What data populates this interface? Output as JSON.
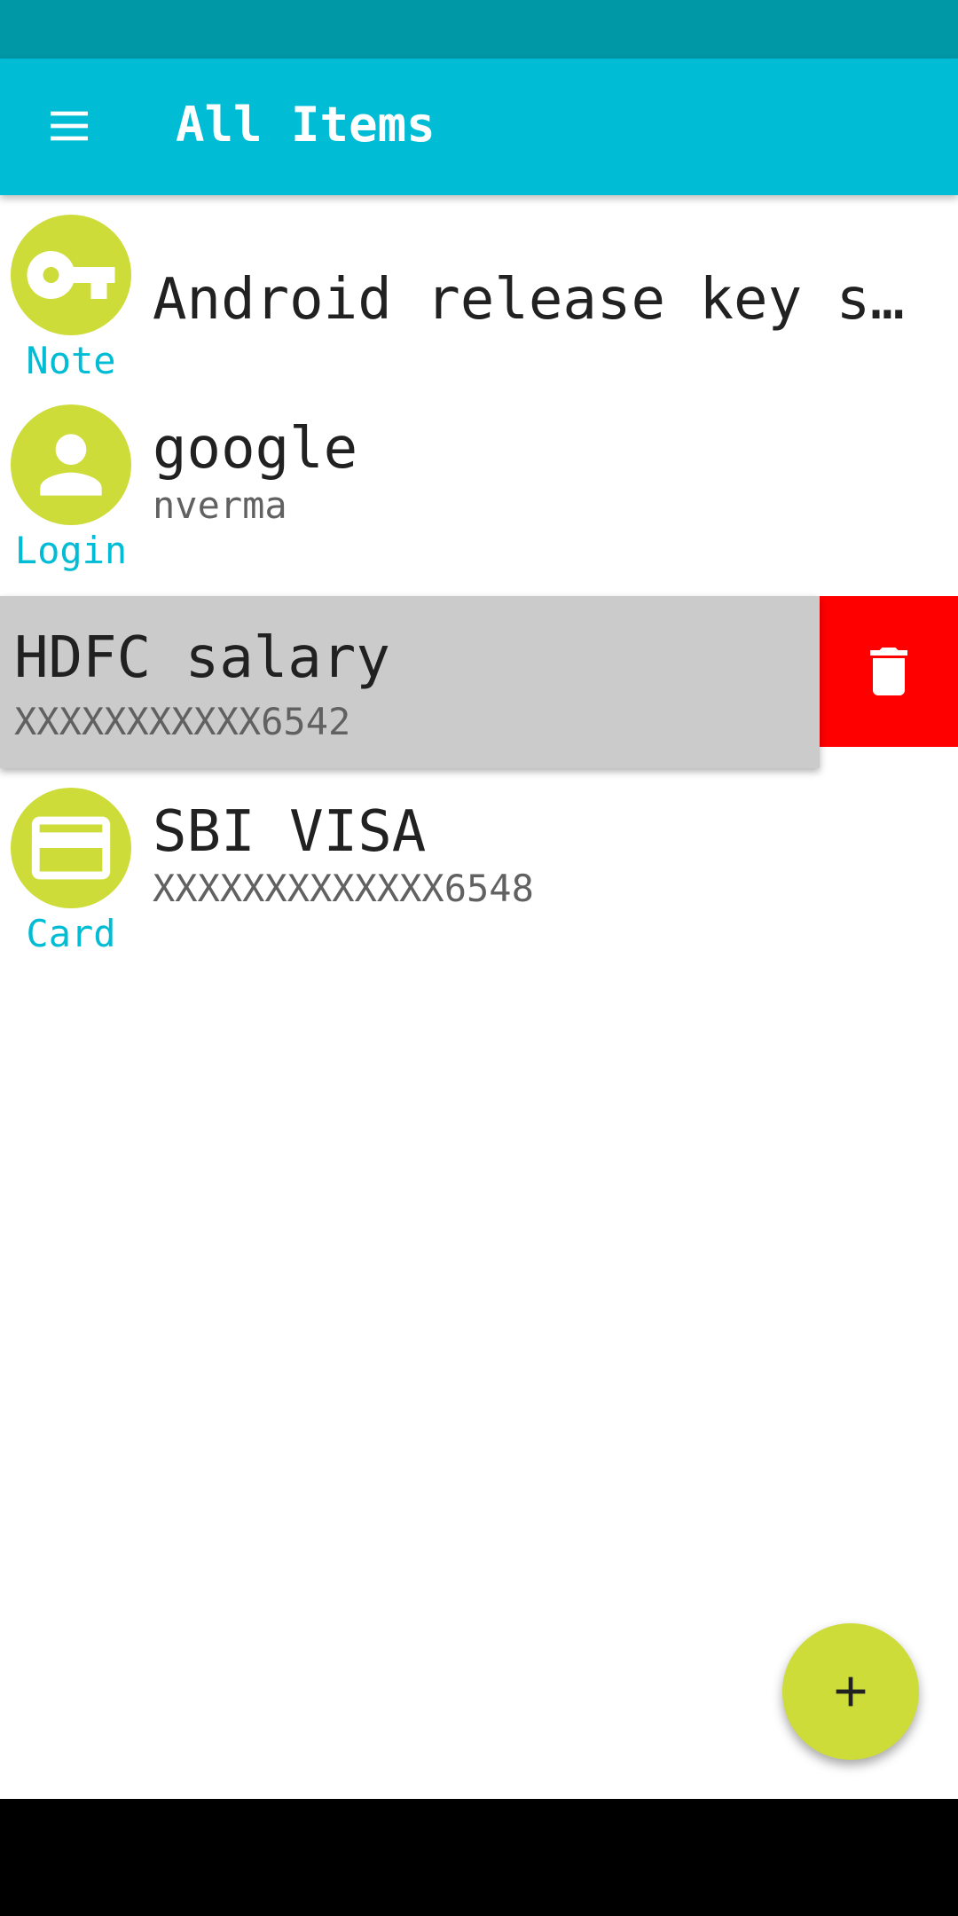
{
  "app_bar": {
    "title": "All Items",
    "menu_icon": "hamburger-menu-icon"
  },
  "items": [
    {
      "type_label": "Note",
      "icon": "key-icon",
      "title": "Android release key s…",
      "subtitle": ""
    },
    {
      "type_label": "Login",
      "icon": "person-icon",
      "title": "google",
      "subtitle": "nverma"
    },
    {
      "type_label": "",
      "icon": "",
      "title": "HDFC salary",
      "subtitle": "XXXXXXXXXXX6542",
      "swiped": true
    },
    {
      "type_label": "Card",
      "icon": "credit-card-icon",
      "title": "SBI VISA",
      "subtitle": "XXXXXXXXXXXXX6548"
    }
  ],
  "swipe_action": {
    "icon": "trash-icon",
    "color": "#ff0000"
  },
  "fab": {
    "icon": "plus-icon"
  },
  "colors": {
    "status_bar": "#0097a7",
    "app_bar": "#00bcd4",
    "accent": "#cddc39",
    "type_label": "#00bcd4"
  }
}
